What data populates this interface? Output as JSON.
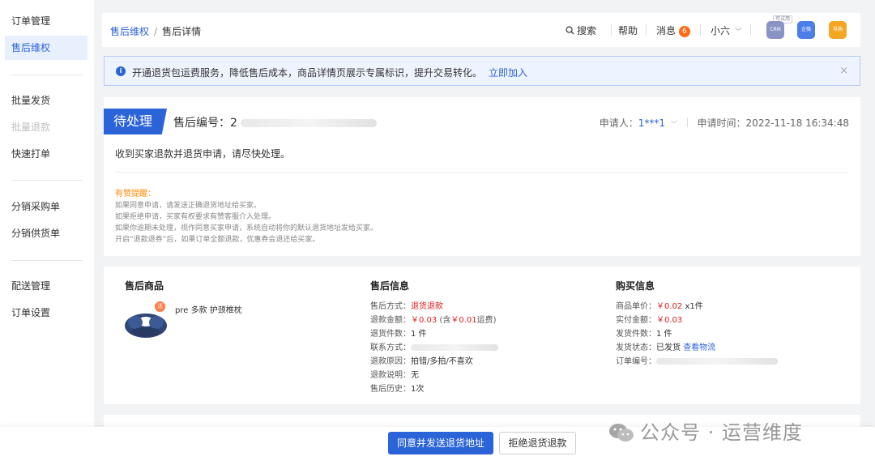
{
  "sidebar": {
    "items": [
      {
        "label": "订单管理"
      },
      {
        "label": "售后维权"
      },
      {
        "label": "批量发货"
      },
      {
        "label": "批量退款"
      },
      {
        "label": "快速打单"
      },
      {
        "label": "分销采购单"
      },
      {
        "label": "分销供货单"
      },
      {
        "label": "配送管理"
      },
      {
        "label": "订单设置"
      }
    ]
  },
  "header": {
    "breadcrumb_parent": "售后维权",
    "breadcrumb_sep": "/",
    "breadcrumb_current": "售后详情",
    "search_label": "搜索",
    "help_label": "帮助",
    "message_label": "消息",
    "message_count": "6",
    "user_name": "小六",
    "apps": {
      "trial_tag": "可试用",
      "crm_label": "CRM",
      "qiwei_label": "企微",
      "guide_label": "导购"
    }
  },
  "notice": {
    "text": "开通退货包运费服务，降低售后成本，商品详情页展示专属标识，提升交易转化。",
    "link": "立即加入",
    "close": "×"
  },
  "status": {
    "tag": "待处理",
    "order_label": "售后编号：",
    "order_prefix": "2",
    "applicant_label": "申请人：",
    "applicant_name": "1***1",
    "apply_time_label": "申请时间：",
    "apply_time": "2022-11-18 16:34:48",
    "description": "收到买家退款并退货申请，请尽快处理。",
    "tips_title": "有赞提醒：",
    "tips": [
      "如果同意申请，请发送正确退货地址给买家。",
      "如果拒绝申请，买家有权要求有赞客服介入处理。",
      "如果你逾期未处理，视作同意买家申请，系统自动将你的默认退货地址发给买家。",
      "开启“退款退券”后，如果订单全额退款，优惠券会退还给买家。"
    ]
  },
  "detail": {
    "product": {
      "title": "售后商品",
      "name": "pre 多款 护颈椎枕",
      "promo_mark": "活"
    },
    "aftersale": {
      "title": "售后信息",
      "method_label": "售后方式：",
      "method": "退货退款",
      "amount_label": "退款金额：",
      "amount": "￥0.03",
      "amount_note_pre": "(含",
      "amount_note_val": "￥0.01",
      "amount_note_post": "运费)",
      "count_label": "退货件数：",
      "count": "1 件",
      "contact_label": "联系方式：",
      "reason_label": "退款原因：",
      "reason": "拍错/多拍/不喜欢",
      "remark_label": "退款说明：",
      "remark": "无",
      "history_label": "售后历史：",
      "history": "1次"
    },
    "purchase": {
      "title": "购买信息",
      "price_label": "商品单价：",
      "price": "￥0.02",
      "qty": "x1件",
      "paid_label": "实付金额：",
      "paid": "￥0.03",
      "ship_count_label": "发货件数：",
      "ship_count": "1 件",
      "ship_status_label": "发货状态：",
      "ship_status": "已发货",
      "logistics_link": "查看物流",
      "order_no_label": "订单编号："
    }
  },
  "footer": {
    "agree_button": "同意并发送退货地址",
    "reject_button": "拒绝退货退款"
  },
  "watermark": {
    "text": "公众号 · 运营维度"
  },
  "colors": {
    "brand_blue": "#2b63d9",
    "price_red": "#e02020",
    "tip_orange": "#ff8a00",
    "badge_orange": "#ff6a1a"
  }
}
